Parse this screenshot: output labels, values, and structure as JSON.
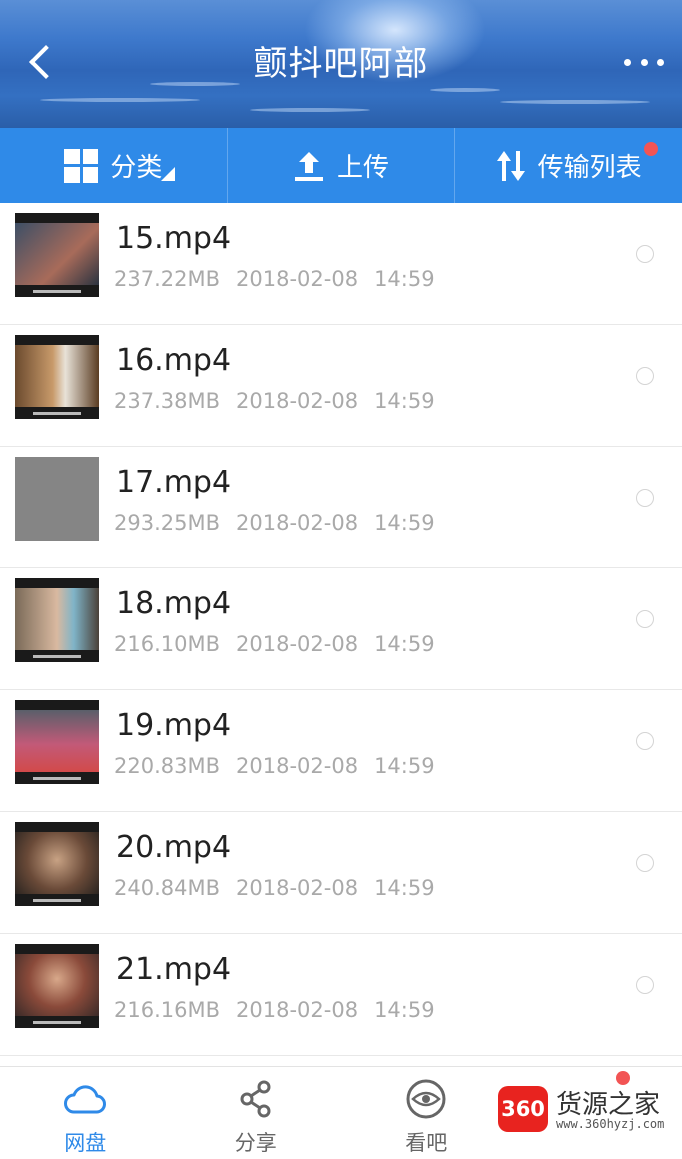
{
  "header": {
    "title": "颤抖吧阿部"
  },
  "toolbar": {
    "category_label": "分类",
    "upload_label": "上传",
    "transfer_label": "传输列表"
  },
  "files": [
    {
      "name": "15.mp4",
      "size": "237.22MB",
      "date": "2018-02-08",
      "time": "14:59"
    },
    {
      "name": "16.mp4",
      "size": "237.38MB",
      "date": "2018-02-08",
      "time": "14:59"
    },
    {
      "name": "17.mp4",
      "size": "293.25MB",
      "date": "2018-02-08",
      "time": "14:59"
    },
    {
      "name": "18.mp4",
      "size": "216.10MB",
      "date": "2018-02-08",
      "time": "14:59"
    },
    {
      "name": "19.mp4",
      "size": "220.83MB",
      "date": "2018-02-08",
      "time": "14:59"
    },
    {
      "name": "20.mp4",
      "size": "240.84MB",
      "date": "2018-02-08",
      "time": "14:59"
    },
    {
      "name": "21.mp4",
      "size": "216.16MB",
      "date": "2018-02-08",
      "time": "14:59"
    }
  ],
  "tabbar": {
    "tabs": [
      {
        "label": "网盘",
        "icon": "cloud-icon"
      },
      {
        "label": "分享",
        "icon": "share-icon"
      },
      {
        "label": "看吧",
        "icon": "eye-icon"
      }
    ]
  },
  "watermark": {
    "logo": "360",
    "name": "货源之家",
    "url": "www.360hyzj.com"
  },
  "colors": {
    "accent": "#2f8ae8",
    "badge": "#f25454",
    "meta_text": "#a9a9a9"
  }
}
